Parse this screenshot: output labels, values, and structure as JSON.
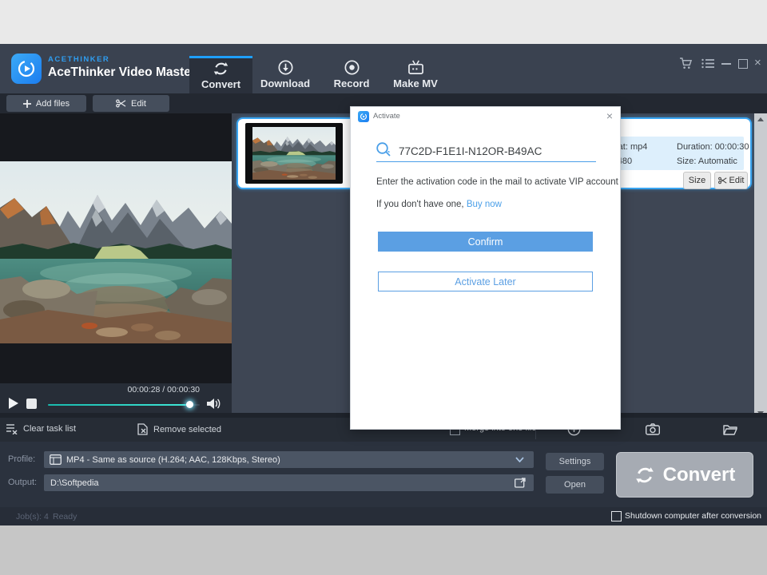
{
  "app": {
    "brand_small": "ACETHINKER",
    "brand": "AceThinker Video Master",
    "tabs": [
      {
        "label": "Convert"
      },
      {
        "label": "Download"
      },
      {
        "label": "Record"
      },
      {
        "label": "Make MV"
      }
    ]
  },
  "toolbar": {
    "add_files_label": "Add files",
    "edit_label": "Edit"
  },
  "preview": {
    "time_display": "00:00:28 / 00:00:30",
    "progress_percent": 93
  },
  "task_item": {
    "format": "Format: mp4",
    "duration": "Duration: 00:00:30",
    "resolution": "640×480",
    "size": "Size: Automatic",
    "size_button": "Size",
    "edit_button": "Edit"
  },
  "dialog": {
    "title": "Activate",
    "activation_code": "77C2D-F1E1I-N12OR-B49AC",
    "instruction": "Enter the activation code in the mail to activate VIP account",
    "no_code_text": "If you don't have one,",
    "buy_now_label": "Buy now",
    "confirm_label": "Confirm",
    "activate_later_label": "Activate Later",
    "close_glyph": "×"
  },
  "action_bar": {
    "clear_label": "Clear task list",
    "remove_label": "Remove selected",
    "merge_label": "Merge into one file"
  },
  "output_panel": {
    "profile_label": "Profile:",
    "profile_value": "MP4 - Same as source (H.264; AAC, 128Kbps, Stereo)",
    "output_label": "Output:",
    "output_value": "D:\\Softpedia",
    "settings_label": "Settings",
    "open_label": "Open",
    "convert_label": "Convert"
  },
  "status_bar": {
    "jobs": "Job(s): 4",
    "state": "Ready",
    "shutdown_label": "Shutdown computer after conversion"
  },
  "icons": {
    "close_window": "×",
    "plus": "+"
  },
  "colors": {
    "accent_blue": "#1e9fff",
    "selection_blue": "#39a5f2",
    "dialog_button_blue": "#5b9fe3",
    "progress_teal": "#3fe7d6",
    "header_bg": "#3a4250",
    "panel_bg": "#3e4654",
    "convert_button_grey": "#a6abb3"
  }
}
